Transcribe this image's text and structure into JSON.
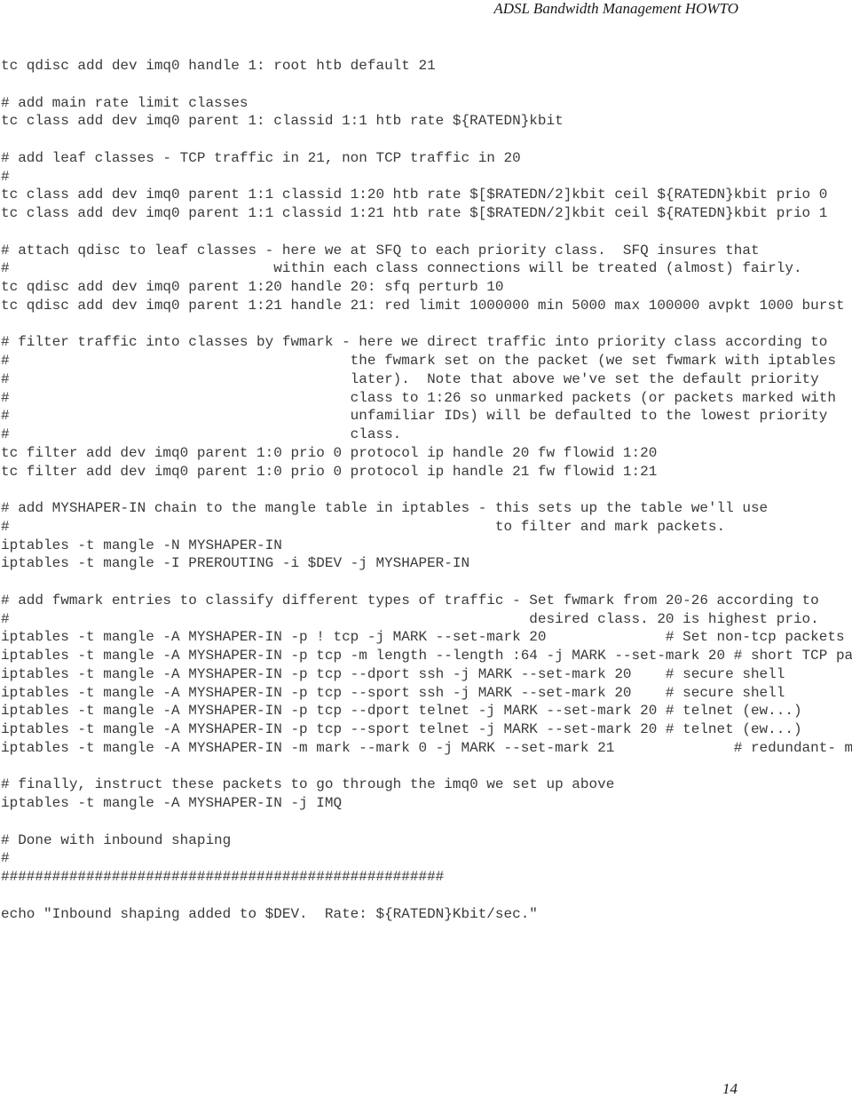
{
  "header": {
    "title": "ADSL Bandwidth Management HOWTO"
  },
  "code_lines": [
    "tc qdisc add dev imq0 handle 1: root htb default 21",
    "",
    "# add main rate limit classes",
    "tc class add dev imq0 parent 1: classid 1:1 htb rate ${RATEDN}kbit",
    "",
    "# add leaf classes - TCP traffic in 21, non TCP traffic in 20",
    "#",
    "tc class add dev imq0 parent 1:1 classid 1:20 htb rate $[$RATEDN/2]kbit ceil ${RATEDN}kbit prio 0",
    "tc class add dev imq0 parent 1:1 classid 1:21 htb rate $[$RATEDN/2]kbit ceil ${RATEDN}kbit prio 1",
    "",
    "# attach qdisc to leaf classes - here we at SFQ to each priority class.  SFQ insures that",
    "#                               within each class connections will be treated (almost) fairly.",
    "tc qdisc add dev imq0 parent 1:20 handle 20: sfq perturb 10",
    "tc qdisc add dev imq0 parent 1:21 handle 21: red limit 1000000 min 5000 max 100000 avpkt 1000 burst",
    "",
    "# filter traffic into classes by fwmark - here we direct traffic into priority class according to",
    "#                                        the fwmark set on the packet (we set fwmark with iptables",
    "#                                        later).  Note that above we've set the default priority",
    "#                                        class to 1:26 so unmarked packets (or packets marked with",
    "#                                        unfamiliar IDs) will be defaulted to the lowest priority",
    "#                                        class.",
    "tc filter add dev imq0 parent 1:0 prio 0 protocol ip handle 20 fw flowid 1:20",
    "tc filter add dev imq0 parent 1:0 prio 0 protocol ip handle 21 fw flowid 1:21",
    "",
    "# add MYSHAPER-IN chain to the mangle table in iptables - this sets up the table we'll use",
    "#                                                         to filter and mark packets.",
    "iptables -t mangle -N MYSHAPER-IN",
    "iptables -t mangle -I PREROUTING -i $DEV -j MYSHAPER-IN",
    "",
    "# add fwmark entries to classify different types of traffic - Set fwmark from 20-26 according to",
    "#                                                             desired class. 20 is highest prio.",
    "iptables -t mangle -A MYSHAPER-IN -p ! tcp -j MARK --set-mark 20              # Set non-tcp packets",
    "iptables -t mangle -A MYSHAPER-IN -p tcp -m length --length :64 -j MARK --set-mark 20 # short TCP pa",
    "iptables -t mangle -A MYSHAPER-IN -p tcp --dport ssh -j MARK --set-mark 20    # secure shell",
    "iptables -t mangle -A MYSHAPER-IN -p tcp --sport ssh -j MARK --set-mark 20    # secure shell",
    "iptables -t mangle -A MYSHAPER-IN -p tcp --dport telnet -j MARK --set-mark 20 # telnet (ew...)",
    "iptables -t mangle -A MYSHAPER-IN -p tcp --sport telnet -j MARK --set-mark 20 # telnet (ew...)",
    "iptables -t mangle -A MYSHAPER-IN -m mark --mark 0 -j MARK --set-mark 21              # redundant- m",
    "",
    "# finally, instruct these packets to go through the imq0 we set up above",
    "iptables -t mangle -A MYSHAPER-IN -j IMQ",
    "",
    "# Done with inbound shaping",
    "#",
    "####################################################",
    "",
    "echo \"Inbound shaping added to $DEV.  Rate: ${RATEDN}Kbit/sec.\""
  ],
  "footer": {
    "page_number": "14"
  }
}
